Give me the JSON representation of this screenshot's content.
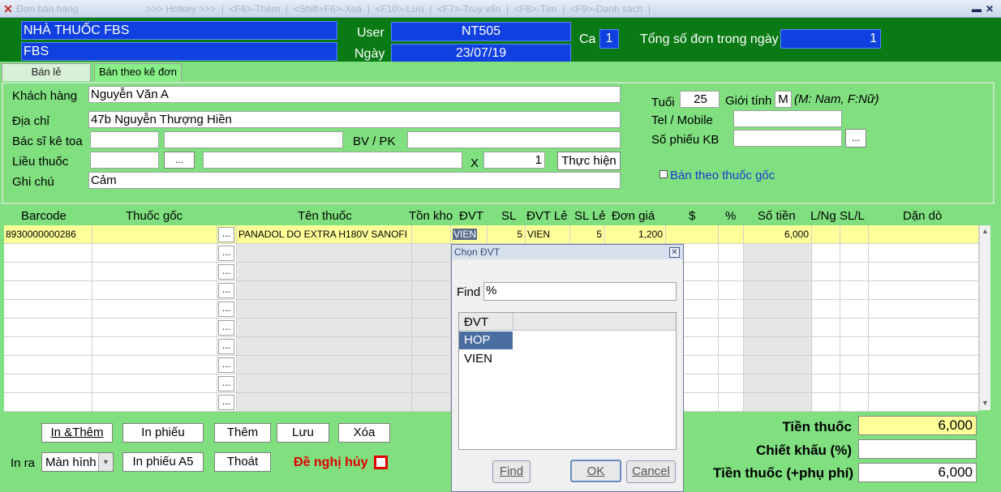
{
  "window": {
    "title": "Đơn bán hàng",
    "hotkeys": ">>> Hotkey >>>  |  <F6>-Thêm  |  <Shift+F6>-Xoá  |  <F10>-Lưu  |  <F7>-Truy vấn  |  <F8>-Tìm  |  <F9>-Danh sách  |"
  },
  "header": {
    "pharmacy_name": "NHÀ THUỐC FBS",
    "branch": "FBS",
    "user_label": "User",
    "user_value": "NT505",
    "date_label": "Ngày",
    "date_value": "23/07/19",
    "shift_label": "Ca",
    "shift_value": "1",
    "total_orders_label": "Tổng số đơn trong ngày",
    "total_orders_value": "1"
  },
  "tabs": [
    {
      "label": "Bán lẻ"
    },
    {
      "label": "Bán theo kê đơn"
    }
  ],
  "form": {
    "customer_label": "Khách hàng",
    "customer_value": "Nguyễn Văn A",
    "address_label": "Địa chỉ",
    "address_value": "47b Nguyễn Thượng Hiền",
    "doctor_label": "Bác sĩ kê toa",
    "hospital_label": "BV / PK",
    "dosage_label": "Liều thuốc",
    "dots": "...",
    "x_label": "X",
    "x_value": "1",
    "execute_button": "Thực hiện",
    "note_label": "Ghi chú",
    "note_value": "Cảm",
    "age_label": "Tuổi",
    "age_value": "25",
    "gender_label": "Giới tính",
    "gender_value": "M",
    "gender_hint": "(M: Nam, F:Nữ)",
    "phone_label": "Tel / Mobile",
    "exam_label": "Số phiếu KB",
    "original_drug_label": "Bán theo thuốc gốc"
  },
  "grid": {
    "columns": [
      "Barcode",
      "Thuốc gốc",
      "Tên thuốc",
      "Tồn kho",
      "ĐVT",
      "SL",
      "ĐVT Lẻ",
      "SL Lẻ",
      "Đơn giá",
      "$",
      "%",
      "Số tiền",
      "L/Ng",
      "SL/L",
      "Dặn dò"
    ],
    "row": {
      "barcode": "8930000000286",
      "generic": "",
      "name": "PANADOL DO  EXTRA H180V SANOFI",
      "unit": "VIEN",
      "qty": "5",
      "retail_unit": "VIEN",
      "retail_qty": "5",
      "price": "1,200",
      "amount": "6,000"
    },
    "dots": "..."
  },
  "buttons": {
    "print_add": "In &Thêm",
    "print_slip": "In phiếu",
    "add": "Thêm",
    "save": "Lưu",
    "delete": "Xóa",
    "output_label": "In ra",
    "output_value": "Màn hình",
    "print_a5": "In phiếu A5",
    "exit": "Thoát",
    "cancel_request": "Đề nghị hủy"
  },
  "summary": {
    "drug_cost_label": "Tiền thuốc",
    "drug_cost_value": "6,000",
    "discount_label": "Chiết khấu (%)",
    "discount_value": "",
    "total_label": "Tiền thuốc (+phụ phí)",
    "total_value": "6,000"
  },
  "dialog": {
    "title": "Chọn ĐVT",
    "find_label": "Find",
    "find_value": "%",
    "list_header": "ĐVT",
    "options": [
      "HOP",
      "VIEN"
    ],
    "find_button": "Find",
    "ok_button": "OK",
    "cancel_button": "Cancel"
  },
  "colors": {
    "header_green": "#0a7a14",
    "panel_green": "#80e080",
    "header_blue": "#1040e0",
    "selected_row": "#ffff99",
    "red_text": "#e00000"
  }
}
